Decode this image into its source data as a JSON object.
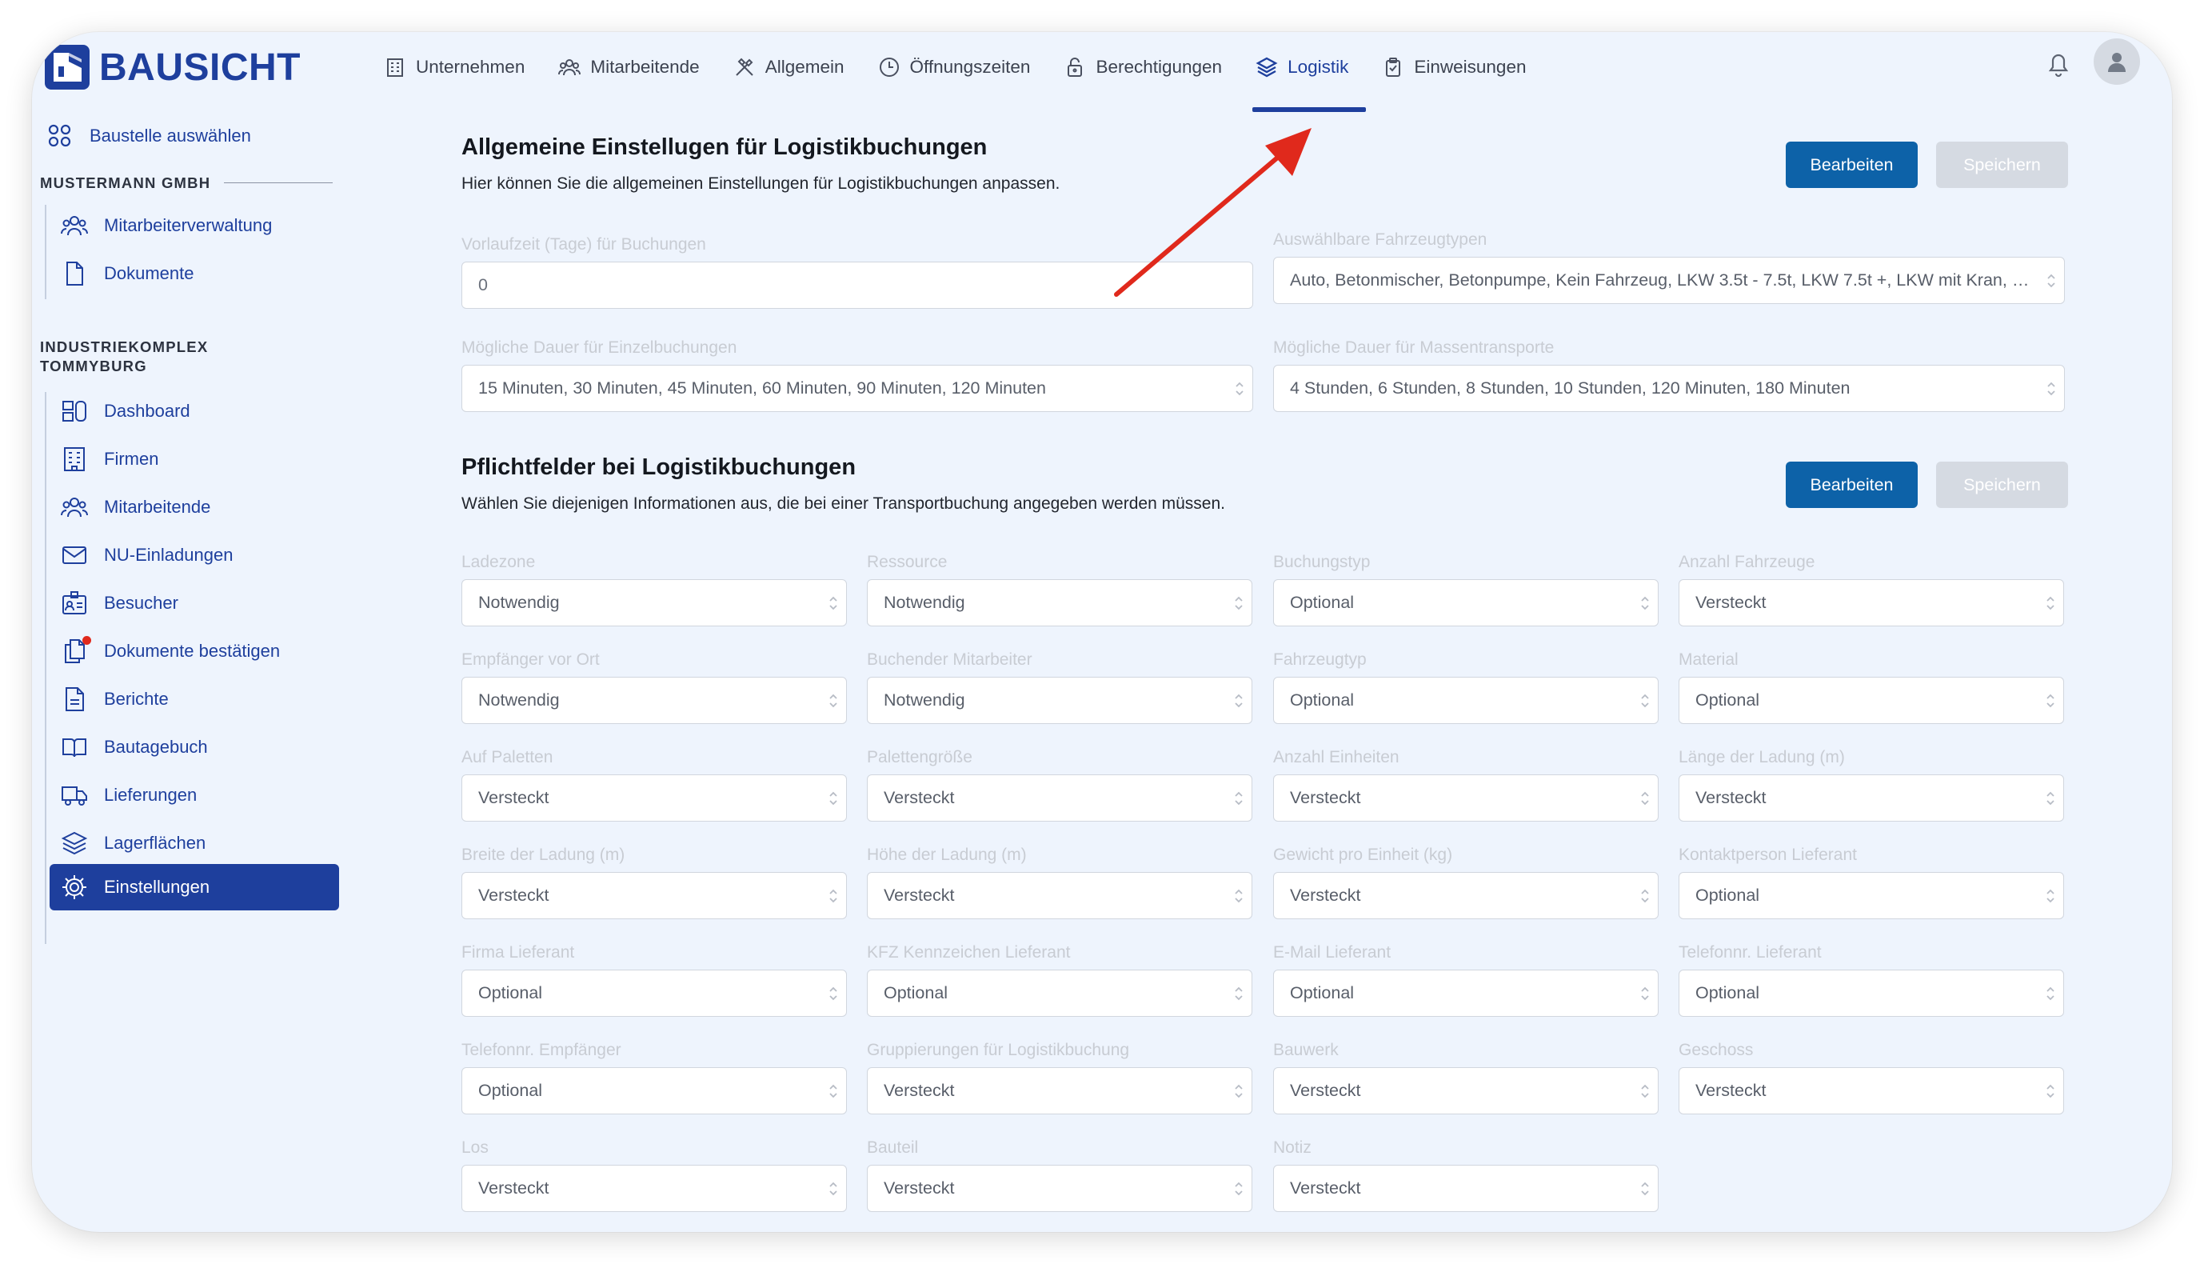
{
  "brand": {
    "name": "BAUSICHT",
    "color": "#1e3f9d"
  },
  "topnav": {
    "tabs": [
      {
        "label": "Unternehmen",
        "icon": "building-icon",
        "active": false
      },
      {
        "label": "Mitarbeitende",
        "icon": "users-icon",
        "active": false
      },
      {
        "label": "Allgemein",
        "icon": "tools-icon",
        "active": false
      },
      {
        "label": "Öffnungszeiten",
        "icon": "clock-icon",
        "active": false
      },
      {
        "label": "Berechtigungen",
        "icon": "lock-icon",
        "active": false
      },
      {
        "label": "Logistik",
        "icon": "layers-icon",
        "active": true
      },
      {
        "label": "Einweisungen",
        "icon": "clipboard-icon",
        "active": false
      }
    ]
  },
  "sidebar": {
    "select_site": "Baustelle auswählen",
    "company": {
      "heading": "MUSTERMANN GMBH",
      "items": [
        {
          "label": "Mitarbeiterverwaltung",
          "icon": "users-icon"
        },
        {
          "label": "Dokumente",
          "icon": "document-icon"
        }
      ]
    },
    "site": {
      "heading_line1": "INDUSTRIEKOMPLEX",
      "heading_line2": "TOMMYBURG",
      "items": [
        {
          "label": "Dashboard",
          "icon": "dashboard-icon",
          "active": false
        },
        {
          "label": "Firmen",
          "icon": "building-icon",
          "active": false
        },
        {
          "label": "Mitarbeitende",
          "icon": "users-icon",
          "active": false
        },
        {
          "label": "NU-Einladungen",
          "icon": "mail-icon",
          "active": false
        },
        {
          "label": "Besucher",
          "icon": "visitor-icon",
          "active": false
        },
        {
          "label": "Dokumente bestätigen",
          "icon": "documents-icon",
          "active": false,
          "badge": true
        },
        {
          "label": "Berichte",
          "icon": "report-icon",
          "active": false
        },
        {
          "label": "Bautagebuch",
          "icon": "book-icon",
          "active": false
        },
        {
          "label": "Lieferungen",
          "icon": "truck-icon",
          "active": false
        },
        {
          "label": "Lagerflächen",
          "icon": "layers-icon",
          "active": false
        },
        {
          "label": "Einstellungen",
          "icon": "gear-icon",
          "active": true
        }
      ]
    }
  },
  "general": {
    "title": "Allgemeine Einstellugen für Logistikbuchungen",
    "description": "Hier können Sie die allgemeinen Einstellungen für Logistikbuchungen anpassen.",
    "edit_label": "Bearbeiten",
    "save_label": "Speichern",
    "fields": [
      {
        "label": "Vorlaufzeit (Tage) für Buchungen",
        "value": "0",
        "kind": "text"
      },
      {
        "label": "Auswählbare Fahrzeugtypen",
        "value": "Auto, Betonmischer, Betonpumpe, Kein Fahrzeug, LKW 3.5t - 7.5t, LKW 7.5t +, LKW mit Kran, Sonstiges",
        "kind": "select"
      },
      {
        "label": "Mögliche Dauer für Einzelbuchungen",
        "value": "15 Minuten, 30 Minuten, 45 Minuten, 60 Minuten, 90 Minuten, 120 Minuten",
        "kind": "select"
      },
      {
        "label": "Mögliche Dauer für Massentransporte",
        "value": "4 Stunden, 6 Stunden, 8 Stunden, 10 Stunden, 120 Minuten, 180 Minuten",
        "kind": "select"
      }
    ]
  },
  "required": {
    "title": "Pflichtfelder bei Logistikbuchungen",
    "description": "Wählen Sie diejenigen Informationen aus, die bei einer Transportbuchung angegeben werden müssen.",
    "edit_label": "Bearbeiten",
    "save_label": "Speichern",
    "fields": [
      {
        "label": "Ladezone",
        "value": "Notwendig"
      },
      {
        "label": "Ressource",
        "value": "Notwendig"
      },
      {
        "label": "Buchungstyp",
        "value": "Optional"
      },
      {
        "label": "Anzahl Fahrzeuge",
        "value": "Versteckt"
      },
      {
        "label": "Empfänger vor Ort",
        "value": "Notwendig"
      },
      {
        "label": "Buchender Mitarbeiter",
        "value": "Notwendig"
      },
      {
        "label": "Fahrzeugtyp",
        "value": "Optional"
      },
      {
        "label": "Material",
        "value": "Optional"
      },
      {
        "label": "Auf Paletten",
        "value": "Versteckt"
      },
      {
        "label": "Palettengröße",
        "value": "Versteckt"
      },
      {
        "label": "Anzahl Einheiten",
        "value": "Versteckt"
      },
      {
        "label": "Länge der Ladung (m)",
        "value": "Versteckt"
      },
      {
        "label": "Breite der Ladung (m)",
        "value": "Versteckt"
      },
      {
        "label": "Höhe der Ladung (m)",
        "value": "Versteckt"
      },
      {
        "label": "Gewicht pro Einheit (kg)",
        "value": "Versteckt"
      },
      {
        "label": "Kontaktperson Lieferant",
        "value": "Optional"
      },
      {
        "label": "Firma Lieferant",
        "value": "Optional"
      },
      {
        "label": "KFZ Kennzeichen Lieferant",
        "value": "Optional"
      },
      {
        "label": "E-Mail Lieferant",
        "value": "Optional"
      },
      {
        "label": "Telefonnr. Lieferant",
        "value": "Optional"
      },
      {
        "label": "Telefonnr. Empfänger",
        "value": "Optional"
      },
      {
        "label": "Gruppierungen für Logistikbuchung",
        "value": "Versteckt"
      },
      {
        "label": "Bauwerk",
        "value": "Versteckt"
      },
      {
        "label": "Geschoss",
        "value": "Versteckt"
      },
      {
        "label": "Los",
        "value": "Versteckt"
      },
      {
        "label": "Bauteil",
        "value": "Versteckt"
      },
      {
        "label": "Notiz",
        "value": "Versteckt"
      }
    ]
  },
  "colors": {
    "brand_blue": "#1e3f9d",
    "button_blue": "#0d62a8",
    "disabled_button": "#d5dae2",
    "background": "#eef4fd",
    "annotation_arrow": "#e0291c",
    "notification_dot": "#e0291c"
  }
}
